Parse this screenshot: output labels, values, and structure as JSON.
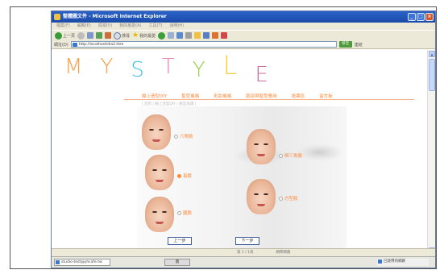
{
  "window": {
    "title": "整體圖文件 - Microsoft Internet Explorer"
  },
  "menubar": {
    "items": [
      "檔案(F)",
      "編輯(E)",
      "檢視(V)",
      "我的最愛(A)",
      "工具(T)",
      "說明(H)"
    ]
  },
  "toolbar": {
    "back_label": "上一頁",
    "search_label": "搜尋",
    "favorites_label": "我的最愛"
  },
  "addressbar": {
    "label": "網址(D)",
    "url": "http://localhost/dia2.htm",
    "go_label": "移至",
    "links_label": "連結"
  },
  "logo": {
    "letters": [
      "M",
      "Y",
      "S",
      "T",
      "Y",
      "L",
      "E"
    ],
    "colors": [
      "#f5a04a",
      "#f5a04a",
      "#3ac1e0",
      "#e889b5",
      "#9bd14a",
      "#f4d33a",
      "#c96d9a"
    ]
  },
  "nav": {
    "items": [
      "線上造型DIY",
      "髮型風格",
      "彩妝風格",
      "臉部與髮型應用",
      "投票區",
      "留言板"
    ]
  },
  "breadcrumb": "| 首頁 | 線上造型DIY | 臉型辨識 |",
  "options": [
    {
      "label": "六角臉",
      "selected": false
    },
    {
      "label": "倒三角臉",
      "selected": false
    },
    {
      "label": "長臉",
      "selected": true
    },
    {
      "label": "方型臉",
      "selected": false
    },
    {
      "label": "圓臉",
      "selected": false
    }
  ],
  "buttons": {
    "prev": "上一步",
    "next": "下一步"
  },
  "statusbar": {
    "text1": "第 1 / 1頁",
    "text2": "",
    "zone": "網際網路"
  },
  "taskbar": {
    "left": "studio-test@yhcafe.tw",
    "middle": "圖",
    "right": "已啟用的網路"
  }
}
